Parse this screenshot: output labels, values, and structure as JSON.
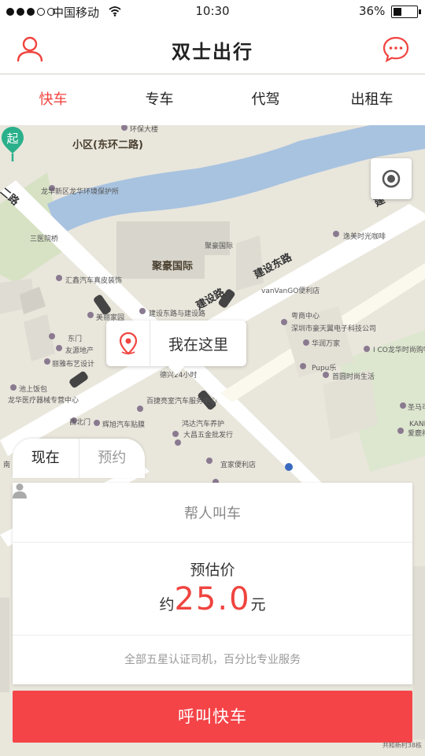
{
  "status_bar": {
    "carrier": "中国移动",
    "time": "10:30",
    "battery": "36%",
    "battery_level": 0.36
  },
  "header": {
    "title": "双士出行",
    "user_icon": "user-icon",
    "message_icon": "chat-bubble-icon"
  },
  "tabs": [
    {
      "label": "快车",
      "active": true
    },
    {
      "label": "专车",
      "active": false
    },
    {
      "label": "代驾",
      "active": false
    },
    {
      "label": "出租车",
      "active": false
    }
  ],
  "map": {
    "labels": {
      "district": "小区(东环二路)",
      "building": "聚豪国际",
      "road1": "建设东路",
      "road2": "建设路",
      "road3": "建",
      "road4": "二路",
      "poi_1": "环保大楼",
      "poi_2": "龙华新区龙华环境保护所",
      "poi_3": "三医院桥",
      "poi_4": "汇鑫汽车真皮装饰",
      "poi_5": "美丽家园",
      "poi_6": "东门",
      "poi_7": "友源地产",
      "poi_8": "丽雅布艺设计",
      "poi_9": "池上饭包",
      "poi_10": "龙华医疗器械专营中心",
      "poi_11": "西北门",
      "poi_12": "辉旭汽车贴膜",
      "poi_13": "聚豪国际",
      "poi_14": "逸美时光咖啡",
      "poi_15": "vanVanGO便利店",
      "poi_16": "建设东路与建设路",
      "poi_17": "粤商中心",
      "poi_18": "深圳市豪天翼电子科技公司",
      "poi_19": "华润万家",
      "poi_20": "I CO龙华时尚购物中心",
      "poi_21": "Pupu乐",
      "poi_22": "首圆时尚生活",
      "poi_23": "德兴24小时",
      "poi_24": "百捷亮室汽车服务中心",
      "poi_25": "鸿达汽车养护",
      "poi_26": "大昌五金批发行",
      "poi_27": "宜家便利店",
      "poi_28": "圣马可",
      "poi_29": "爱鹿神桥",
      "poi_30": "KANI尼亚",
      "poi_31": "南",
      "watermark": "共和新村38栋"
    },
    "locate_icon": "target-locate-icon",
    "here_label": "我在这里",
    "here_icon": "location-pin-icon",
    "start_label": "起"
  },
  "time_toggle": {
    "now": "现在",
    "reserve": "预约"
  },
  "card": {
    "call_for_others": "帮人叫车",
    "estimate_label": "预估价",
    "price_prefix": "约",
    "price": "25.0",
    "price_unit": "元",
    "note": "全部五星认证司机，百分比专业服务"
  },
  "call_button": "呼叫快车",
  "colors": {
    "accent": "#f0443f",
    "button": "#f44448",
    "map_bg": "#e9e6dc",
    "river": "#a8c3e0",
    "road": "#ffffff",
    "building": "#d8d5cc",
    "green": "#cfe0b8",
    "start_pin": "#2ab08a"
  }
}
